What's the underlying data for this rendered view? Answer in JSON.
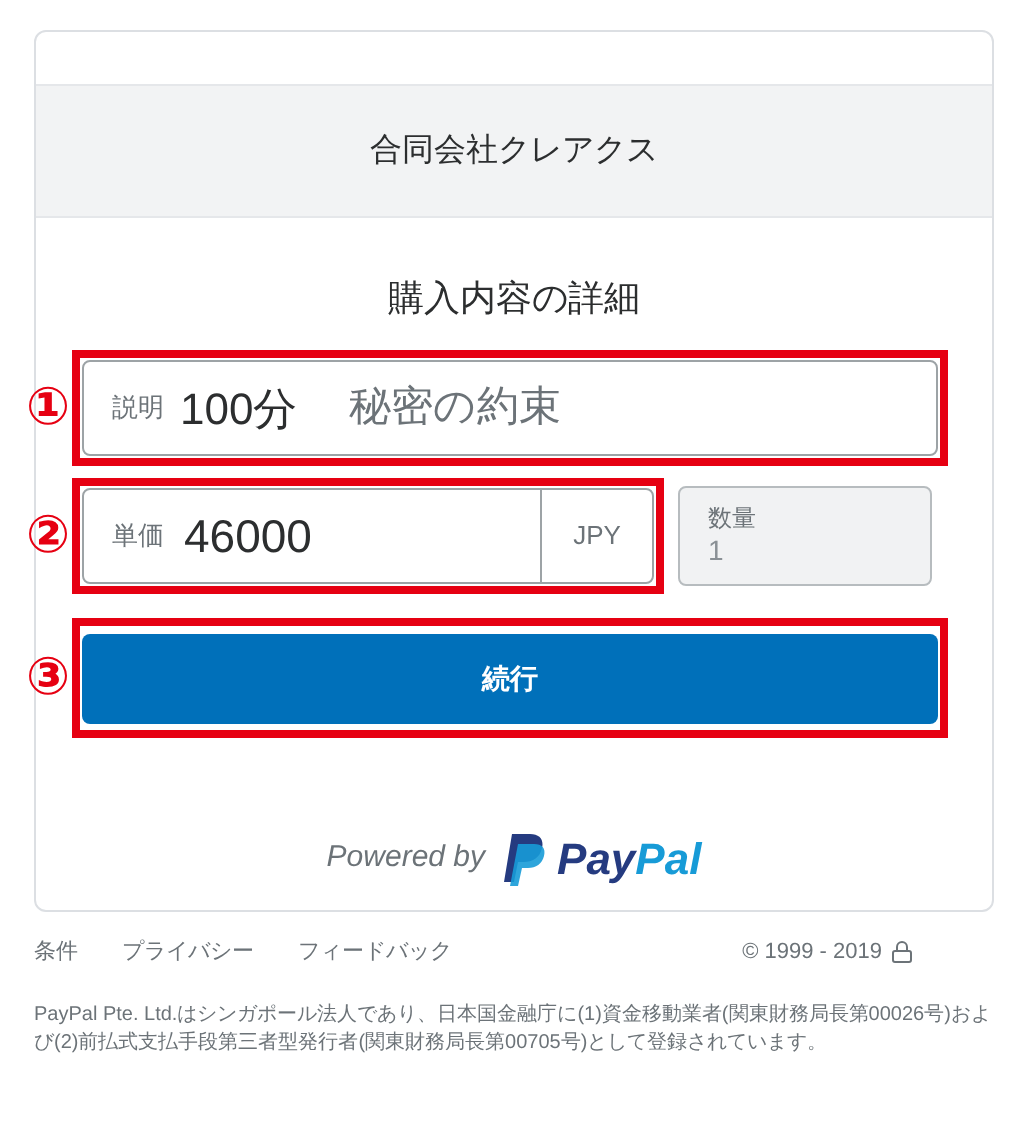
{
  "merchant": "合同会社クレアクス",
  "heading": "購入内容の詳細",
  "annotations": [
    "①",
    "②",
    "③"
  ],
  "description": {
    "label": "説明",
    "value": "100分",
    "note": "秘密の約束"
  },
  "price": {
    "label": "単価",
    "value": "46000",
    "currency": "JPY"
  },
  "quantity": {
    "label": "数量",
    "value": "1",
    "disabled": true
  },
  "continue_button": "続行",
  "powered_by": {
    "text": "Powered by",
    "brand_parts": [
      {
        "text": "Pay",
        "color": "#253b80"
      },
      {
        "text": "Pal",
        "color": "#179bd7"
      }
    ]
  },
  "footer_links": [
    "条件",
    "プライバシー",
    "フィードバック"
  ],
  "copyright": "© 1999 - 2019",
  "legal": "PayPal Pte. Ltd.はシンガポール法人であり、日本国金融庁に(1)資金移動業者(関東財務局長第00026号)および(2)前払式支払手段第三者型発行者(関東財務局長第00705号)として登録されています。"
}
